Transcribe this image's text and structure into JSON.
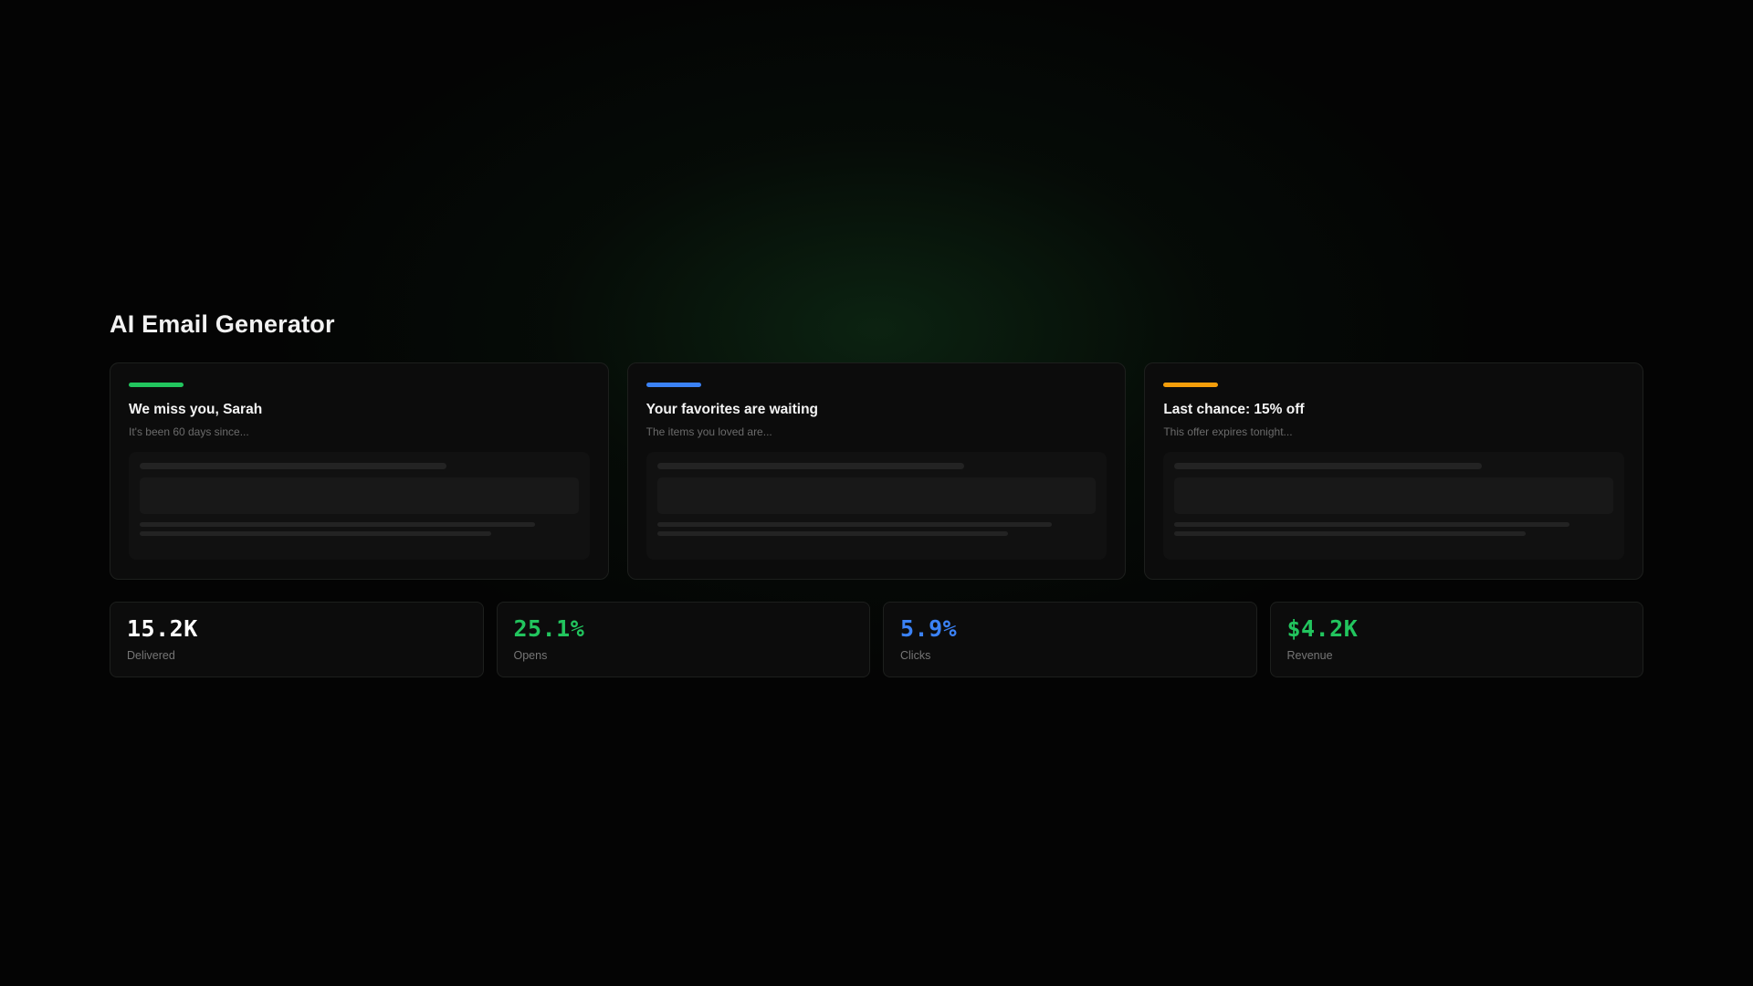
{
  "page": {
    "title": "AI Email Generator"
  },
  "cards": [
    {
      "title": "We miss you, Sarah",
      "subtitle": "It's been 60 days since...",
      "accent_color": "#22c55e"
    },
    {
      "title": "Your favorites are waiting",
      "subtitle": "The items you loved are...",
      "accent_color": "#3b82f6"
    },
    {
      "title": "Last chance: 15% off",
      "subtitle": "This offer expires tonight...",
      "accent_color": "#f59e0b"
    }
  ],
  "stats": [
    {
      "value": "15.2K",
      "label": "Delivered",
      "color": "#ffffff"
    },
    {
      "value": "25.1%",
      "label": "Opens",
      "color": "#22c55e"
    },
    {
      "value": "5.9%",
      "label": "Clicks",
      "color": "#3b82f6"
    },
    {
      "value": "$4.2K",
      "label": "Revenue",
      "color": "#22c55e"
    }
  ]
}
